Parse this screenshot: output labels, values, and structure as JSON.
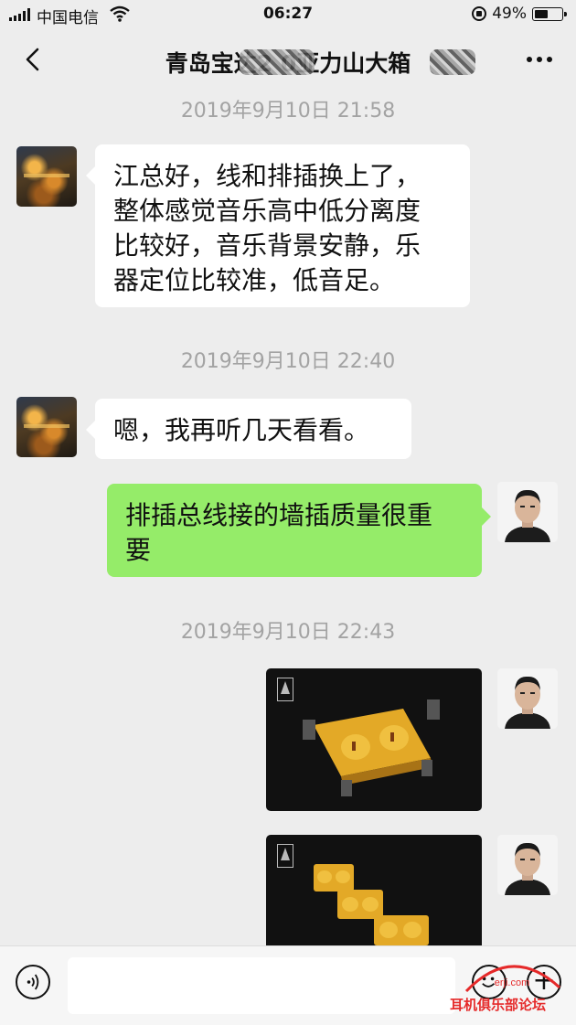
{
  "status_bar": {
    "carrier": "中国电信",
    "time": "06:27",
    "battery": "49%",
    "battery_level": 0.49
  },
  "nav": {
    "title": "青岛宝达2 0亚力山大箱",
    "back_icon": "chevron-left-icon",
    "more_icon": "more-dots-icon"
  },
  "messages": {
    "ts1": "2019年9月10日 21:58",
    "msg1": [
      "江总好，线和排插换上了，",
      "整体感觉音乐高中低分离度",
      "比较好，音乐背景安静，乐",
      "器定位比较准，低音足。"
    ],
    "ts2": "2019年9月10日 22:40",
    "msg2": "嗯，我再听几天看看。",
    "msg3": [
      "排插总线接的墙插质量很重",
      "要"
    ],
    "ts3": "2019年9月10日 22:43"
  },
  "input_bar": {
    "voice_icon": "voice-icon",
    "emoji_icon": "emoji-icon",
    "plus_icon": "plus-icon"
  },
  "watermark": {
    "text": "耳机俱乐部论坛",
    "logo_text": "erji.com"
  },
  "colors": {
    "background": "#ededed",
    "outgoing_bubble": "#95ec69",
    "incoming_bubble": "#ffffff",
    "timestamp": "#a3a3a3",
    "watermark": "#e52a2a"
  }
}
